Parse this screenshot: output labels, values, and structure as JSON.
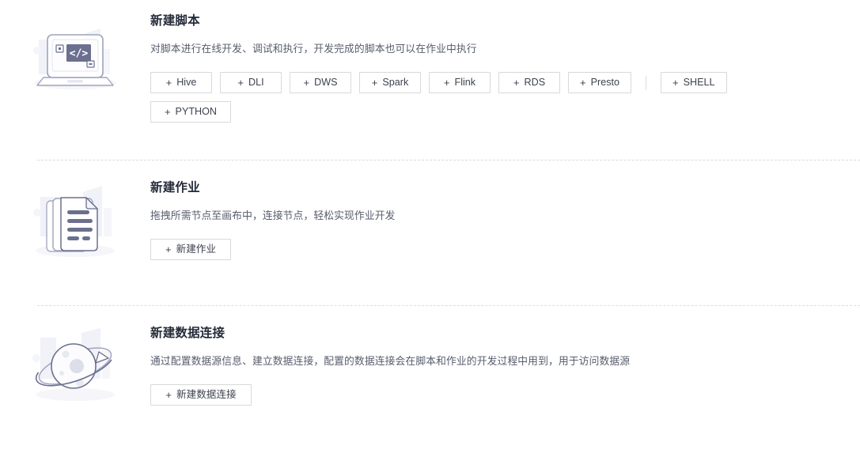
{
  "sections": [
    {
      "id": "new-script",
      "icon": "laptop-code-illustration",
      "title": "新建脚本",
      "description": "对脚本进行在线开发、调试和执行，开发完成的脚本也可以在作业中执行",
      "buttons": [
        {
          "label": "Hive",
          "icon": "plus-icon"
        },
        {
          "label": "DLI",
          "icon": "plus-icon"
        },
        {
          "label": "DWS",
          "icon": "plus-icon"
        },
        {
          "label": "Spark",
          "icon": "plus-icon"
        },
        {
          "label": "Flink",
          "icon": "plus-icon"
        },
        {
          "label": "RDS",
          "icon": "plus-icon"
        },
        {
          "label": "Presto",
          "icon": "plus-icon"
        },
        {
          "label": "SHELL",
          "icon": "plus-icon"
        },
        {
          "label": "PYTHON",
          "icon": "plus-icon"
        }
      ],
      "divider_after_index": 6
    },
    {
      "id": "new-job",
      "icon": "documents-illustration",
      "title": "新建作业",
      "description": "拖拽所需节点至画布中，连接节点，轻松实现作业开发",
      "buttons": [
        {
          "label": "新建作业",
          "icon": "plus-icon"
        }
      ]
    },
    {
      "id": "new-data-connection",
      "icon": "planet-illustration",
      "title": "新建数据连接",
      "description": "通过配置数据源信息、建立数据连接，配置的数据连接会在脚本和作业的开发过程中用到，用于访问数据源",
      "buttons": [
        {
          "label": "新建数据连接",
          "icon": "plus-icon"
        }
      ]
    }
  ],
  "plus_glyph": "+",
  "colors": {
    "background": "#ffffff",
    "title": "#252b3a",
    "description": "#575d6c",
    "button_border": "#d9d9d9",
    "button_text": "#3d424e",
    "separator": "#dcdcdc",
    "illustration_primary": "#6b708f",
    "illustration_light": "#f0f1f7"
  }
}
